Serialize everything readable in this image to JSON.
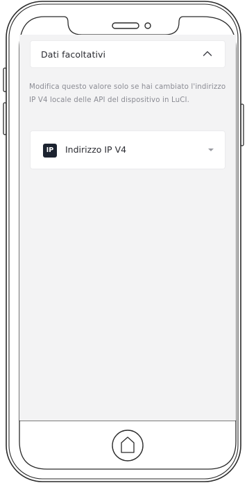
{
  "optional_section": {
    "title": "Dati facoltativi",
    "expanded": true,
    "icon": "chevron-up-icon"
  },
  "help_text": "Modifica questo valore solo se hai cambiato l'indirizzo IP V4 locale delle API del dispositivo in LuCI.",
  "ip_field": {
    "badge": "IP",
    "label": "Indirizzo IP V4",
    "icon": "dropdown-caret-icon"
  },
  "colors": {
    "screen_background": "#f3f3f4",
    "badge_background": "#1c2330",
    "help_text": "#8a8b93"
  }
}
